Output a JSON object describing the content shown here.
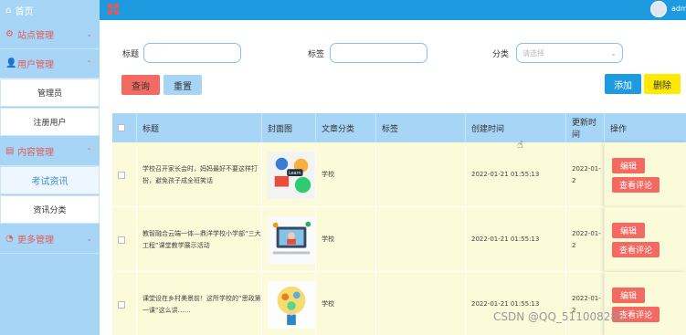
{
  "sidebar": {
    "home": "首页",
    "groups": [
      {
        "label": "站点管理",
        "icon": "gear-icon"
      },
      {
        "label": "用户管理",
        "icon": "user-icon"
      },
      {
        "label": "内容管理",
        "icon": "document-icon"
      },
      {
        "label": "更多管理",
        "icon": "more-icon"
      }
    ],
    "user_items": [
      "管理员",
      "注册用户"
    ],
    "content_items": [
      "考试资讯",
      "资讯分类"
    ]
  },
  "header": {
    "user": "adm"
  },
  "search": {
    "title_label": "标题",
    "tag_label": "标签",
    "category_label": "分类",
    "category_placeholder": "请选择",
    "query_button": "查询",
    "reset_button": "重置",
    "add_button": "添加",
    "delete_button": "删除"
  },
  "table": {
    "headers": [
      "标题",
      "封面图",
      "文章分类",
      "标签",
      "创建时间",
      "更新时间",
      "操作"
    ],
    "rows": [
      {
        "title": "学校召开家长会时，妈妈最好不要这样打扮，避免孩子成全班笑话",
        "category": "学校",
        "tag": "",
        "created": "2022-01-21 01:55:13",
        "updated": "2022-01-2",
        "image_icon": "learn-illustration"
      },
      {
        "title": "教智融合云端一体—鼎洋学校小学部“三大工程”课堂教学展示活动",
        "category": "学校",
        "tag": "",
        "created": "2022-01-21 01:55:13",
        "updated": "2022-01-2",
        "image_icon": "online-class-illustration"
      },
      {
        "title": "课堂设在乡村美景前！这所学校的“思政第一课”这么讲……",
        "category": "学校",
        "tag": "",
        "created": "2022-01-21 01:55:13",
        "updated": "2022-01-2",
        "image_icon": "education-illustration"
      }
    ],
    "edit_button": "编辑",
    "comment_button": "查看评论"
  },
  "watermark": "CSDN @QQ_511008285",
  "colors": {
    "sidebar": "#a7d5f5",
    "topbar": "#1e9be0",
    "danger": "#f26a61",
    "row_bg": "#fbfbd9",
    "warn": "#ffe900"
  }
}
